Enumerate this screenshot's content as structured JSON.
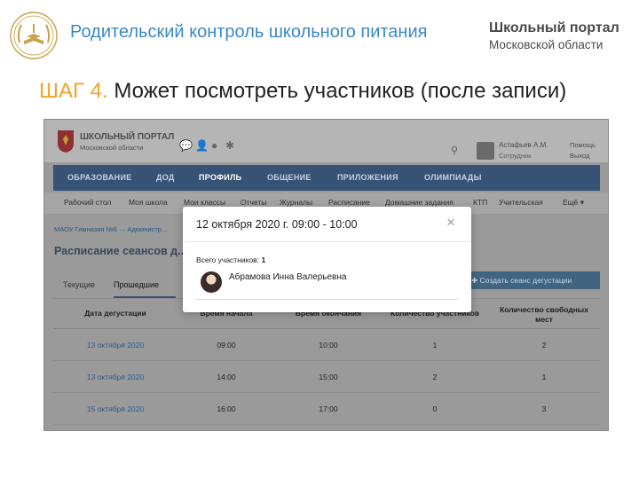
{
  "slide": {
    "header_title": "Родительский контроль школьного питания",
    "brand_name": "Школьный портал",
    "brand_region": "Московской области",
    "step_word": "ШАГ 4.",
    "step_text": "Может посмотреть участников (после записи)"
  },
  "portal": {
    "name": "ШКОЛЬНЫЙ ПОРТАЛ",
    "region": "Московской области",
    "user_name": "Астафьев А.М.",
    "user_role": "Сотрудник",
    "help": "Помощь",
    "exit": "Выход"
  },
  "nav": [
    "ОБРАЗОВАНИЕ",
    "ДОД",
    "ПРОФИЛЬ",
    "ОБЩЕНИЕ",
    "ПРИЛОЖЕНИЯ",
    "ОЛИМПИАДЫ"
  ],
  "submenu": [
    "Рабочий стол",
    "Моя школа",
    "Мои классы",
    "Отчеты",
    "Журналы",
    "Расписание",
    "Домашние задания",
    "КТП",
    "Учительская",
    "Ещё ▾"
  ],
  "breadcrumbs": "МАОУ Гимназия №6  →  Администр...",
  "page_title": "Расписание сеансов д...",
  "tabs": [
    "Текущие",
    "Прошедшие"
  ],
  "create_button": "Создать сеанс дегустации",
  "table": {
    "headers": [
      "Дата дегустации",
      "Время начала",
      "Время окончания",
      "Количество участников",
      "Количество свободных мест"
    ],
    "rows": [
      [
        "13 октября 2020",
        "09:00",
        "10:00",
        "1",
        "2"
      ],
      [
        "13 октября 2020",
        "14:00",
        "15:00",
        "2",
        "1"
      ],
      [
        "15 октября 2020",
        "16:00",
        "17:00",
        "0",
        "3"
      ]
    ]
  },
  "modal": {
    "title": "12 октября 2020 г. 09:00 - 10:00",
    "count_label": "Всего участников:",
    "count_value": "1",
    "participant": "Абрамова Инна Валерьевна",
    "close": "×"
  }
}
